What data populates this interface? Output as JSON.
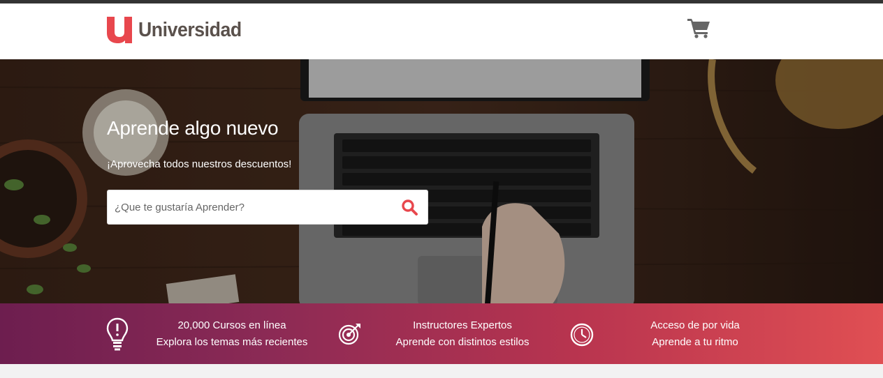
{
  "header": {
    "logo_text": "Universidad",
    "logo_mark_color": "#e8474d",
    "cart_icon": "shopping-cart-icon"
  },
  "hero": {
    "title": "Aprende algo nuevo",
    "subtitle": "¡Aprovecha todos nuestros descuentos!",
    "search": {
      "placeholder": "¿Que te gustaría Aprender?",
      "value": "",
      "button_icon": "search-icon",
      "icon_color": "#e8474d"
    }
  },
  "features": [
    {
      "icon": "lightbulb-icon",
      "line1": "20,000 Cursos en línea",
      "line2": "Explora los temas más recientes"
    },
    {
      "icon": "target-icon",
      "line1": "Instructores Expertos",
      "line2": "Aprende con distintos estilos"
    },
    {
      "icon": "clock-icon",
      "line1": "Acceso de por vida",
      "line2": "Aprende a tu ritmo"
    }
  ],
  "colors": {
    "brand_red": "#e8474d",
    "band_start": "#6d1e4f",
    "band_end": "#e04f53"
  }
}
